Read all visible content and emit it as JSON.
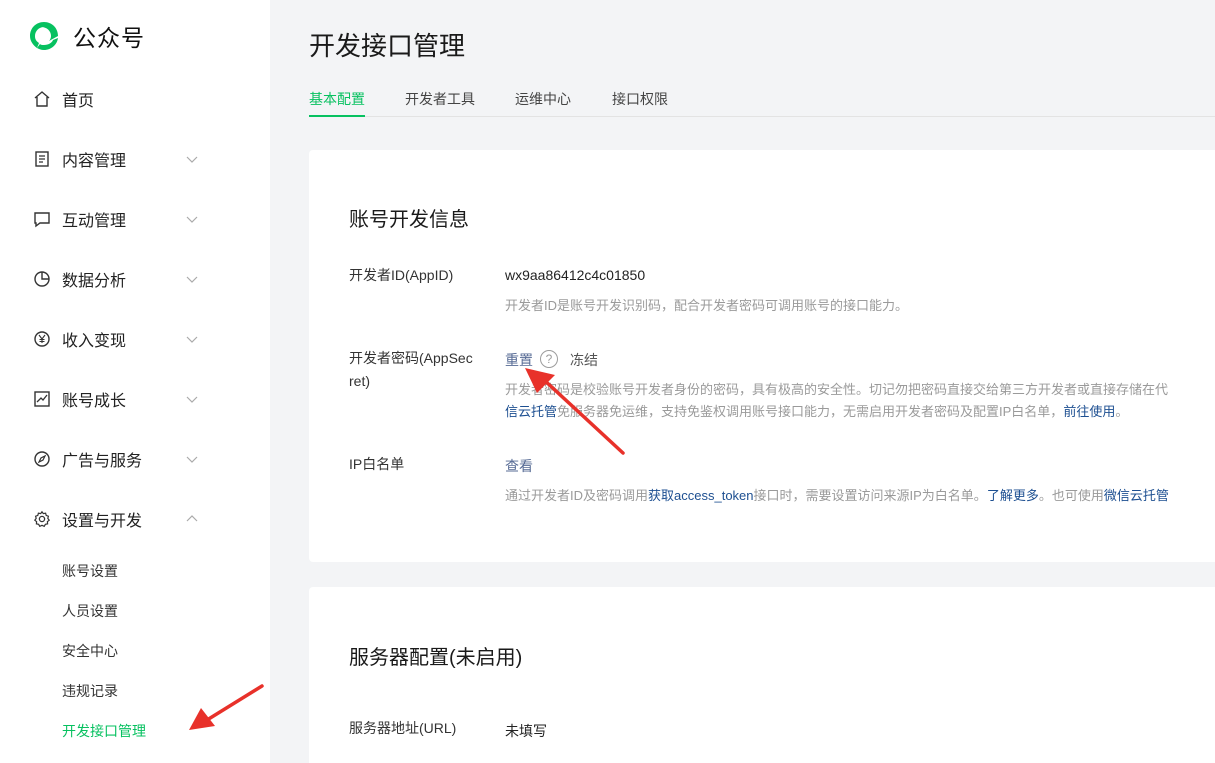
{
  "brand": {
    "name": "公众号"
  },
  "nav": [
    {
      "label": "首页",
      "icon": "home-icon"
    },
    {
      "label": "内容管理",
      "icon": "document-icon"
    },
    {
      "label": "互动管理",
      "icon": "chat-icon"
    },
    {
      "label": "数据分析",
      "icon": "pie-chart-icon"
    },
    {
      "label": "收入变现",
      "icon": "yen-icon"
    },
    {
      "label": "账号成长",
      "icon": "trend-icon"
    },
    {
      "label": "广告与服务",
      "icon": "compass-icon"
    },
    {
      "label": "设置与开发",
      "icon": "gear-icon"
    }
  ],
  "subnav": [
    "账号设置",
    "人员设置",
    "安全中心",
    "违规记录",
    "开发接口管理"
  ],
  "page": {
    "title": "开发接口管理"
  },
  "tabs": [
    "基本配置",
    "开发者工具",
    "运维中心",
    "接口权限"
  ],
  "account_info": {
    "title": "账号开发信息",
    "appid_label": "开发者ID(AppID)",
    "appid_value": "wx9aa86412c4c01850",
    "appid_desc": "开发者ID是账号开发识别码，配合开发者密码可调用账号的接口能力。",
    "secret_label_1": "开发者密码(AppSec",
    "secret_label_2": "ret)",
    "secret_reset": "重置",
    "secret_help": "?",
    "secret_freeze": "冻结",
    "secret_desc_1": "开发者密码是校验账号开发者身份的密码，具有极高的安全性。切记勿把密码直接交给第三方开发者或直接存储在代",
    "secret_desc_2a": "信云托管",
    "secret_desc_2b": "免服务器免运维，支持免鉴权调用账号接口能力，无需启用开发者密码及配置IP白名单，",
    "secret_desc_2c": "前往使用",
    "secret_desc_2d": "。",
    "ip_label": "IP白名单",
    "ip_view": "查看",
    "ip_desc_a": "通过开发者ID及密码调用",
    "ip_desc_b": "获取access_token",
    "ip_desc_c": "接口时，需要设置访问来源IP为白名单。",
    "ip_desc_d": "了解更多",
    "ip_desc_e": "。也可使用",
    "ip_desc_f": "微信云托管"
  },
  "server_config": {
    "title": "服务器配置(未启用)",
    "url_label": "服务器地址(URL)",
    "url_value": "未填写"
  },
  "colors": {
    "accent": "#07c160",
    "link": "#576b95",
    "arrow": "#e8312a"
  }
}
